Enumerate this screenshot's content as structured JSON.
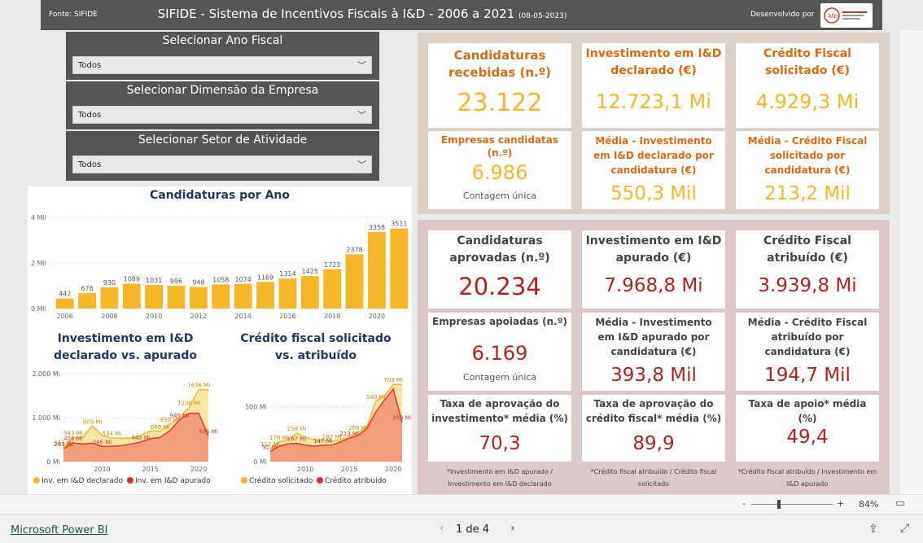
{
  "header": {
    "source": "Fonte: SIFIDE",
    "title": "SIFIDE - Sistema de Incentivos Fiscais à I&D - 2006 a 2021",
    "date": "(08-05-2023)",
    "developed_by": "Desenvolvido por",
    "logo_text": "ANI"
  },
  "slicers": [
    {
      "title": "Selecionar Ano Fiscal",
      "value": "Todos"
    },
    {
      "title": "Selecionar Dimensão da Empresa",
      "value": "Todos"
    },
    {
      "title": "Selecionar Setor de Atividade",
      "value": "Todos"
    }
  ],
  "chart_data": [
    {
      "type": "bar",
      "title": "Candidaturas por Ano",
      "categories": [
        "2006",
        "2007",
        "2008",
        "2009",
        "2010",
        "2011",
        "2012",
        "2013",
        "2014",
        "2015",
        "2016",
        "2017",
        "2018",
        "2019",
        "2020",
        "2021"
      ],
      "values": [
        442,
        676,
        930,
        1089,
        1031,
        996,
        948,
        1058,
        1074,
        1169,
        1314,
        1425,
        1723,
        2378,
        3358,
        3511
      ],
      "x_tick_labels": [
        "2006",
        "2008",
        "2010",
        "2012",
        "2014",
        "2016",
        "2018",
        "2020"
      ],
      "y_tick_labels": [
        "0 Mil",
        "2 Mil",
        "4 Mil"
      ],
      "ylim": [
        0,
        4000
      ],
      "color": "#f5b728"
    },
    {
      "type": "area",
      "title": "Investimento em I&D declarado vs. apurado",
      "x": [
        2006,
        2007,
        2008,
        2009,
        2010,
        2011,
        2012,
        2013,
        2014,
        2015,
        2016,
        2017,
        2018,
        2019,
        2020,
        2021
      ],
      "series": [
        {
          "name": "Inv. em I&D declarado",
          "color": "#f5b728",
          "values": [
            323,
            543,
            560,
            809,
            600,
            534,
            530,
            540,
            600,
            700,
            689,
            850,
            1000,
            1230,
            1636,
            1636
          ]
        },
        {
          "name": "Inv. em I&D apurado",
          "color": "#e85c4a",
          "values": [
            293,
            426,
            400,
            420,
            346,
            350,
            360,
            400,
            445,
            520,
            550,
            700,
            945,
            1100,
            1100,
            585
          ]
        }
      ],
      "data_labels": [
        {
          "text": "323 Mi",
          "series": 0,
          "x": 2006
        },
        {
          "text": "543 Mi",
          "series": 0,
          "x": 2007
        },
        {
          "text": "809 Mi",
          "series": 0,
          "x": 2009
        },
        {
          "text": "534 Mi",
          "series": 0,
          "x": 2011
        },
        {
          "text": "689 Mi",
          "series": 0,
          "x": 2016
        },
        {
          "text": "850 Mi",
          "series": 0,
          "x": 2017
        },
        {
          "text": "1230 Mi",
          "series": 0,
          "x": 2019
        },
        {
          "text": "1636 Mi",
          "series": 0,
          "x": 2020
        },
        {
          "text": "293 Mi",
          "series": 1,
          "x": 2006
        },
        {
          "text": "426 Mi",
          "series": 1,
          "x": 2007
        },
        {
          "text": "346 Mi",
          "series": 1,
          "x": 2010
        },
        {
          "text": "445 Mi",
          "series": 1,
          "x": 2014
        },
        {
          "text": "945 Mi",
          "series": 1,
          "x": 2018
        },
        {
          "text": "585 Mi",
          "series": 1,
          "x": 2021
        }
      ],
      "x_tick_labels": [
        "2010",
        "2015",
        "2020"
      ],
      "y_tick_labels": [
        "0 Mi",
        "1.000 Mi",
        "2.000 Mi"
      ],
      "ylim": [
        0,
        2000
      ]
    },
    {
      "type": "area",
      "title": "Crédito fiscal solicitado vs. atribuído",
      "x": [
        2006,
        2007,
        2008,
        2009,
        2010,
        2011,
        2012,
        2013,
        2014,
        2015,
        2016,
        2017,
        2018,
        2019,
        2020,
        2021
      ],
      "series": [
        {
          "name": "Crédito solicitado",
          "color": "#f5b728",
          "values": [
            117,
            178,
            200,
            258,
            220,
            200,
            190,
            187,
            200,
            230,
            268,
            320,
            549,
            600,
            703,
            703
          ]
        },
        {
          "name": "Crédito atribuído",
          "color": "#e85c4a",
          "values": [
            92,
            140,
            160,
            167,
            150,
            140,
            147,
            150,
            180,
            213,
            240,
            300,
            450,
            560,
            660,
            358
          ]
        }
      ],
      "data_labels": [
        {
          "text": "117 Mi",
          "series": 0,
          "x": 2006
        },
        {
          "text": "178 Mi",
          "series": 0,
          "x": 2007
        },
        {
          "text": "258 Mi",
          "series": 0,
          "x": 2009
        },
        {
          "text": "187 Mi",
          "series": 0,
          "x": 2013
        },
        {
          "text": "268 Mi",
          "series": 0,
          "x": 2016
        },
        {
          "text": "549 Mi",
          "series": 0,
          "x": 2018
        },
        {
          "text": "703 Mi",
          "series": 0,
          "x": 2020
        },
        {
          "text": "92 Mi",
          "series": 1,
          "x": 2006
        },
        {
          "text": "167 Mi",
          "series": 1,
          "x": 2009
        },
        {
          "text": "147 Mi",
          "series": 1,
          "x": 2012
        },
        {
          "text": "213 Mi",
          "series": 1,
          "x": 2015
        },
        {
          "text": "358 Mi",
          "series": 1,
          "x": 2021
        }
      ],
      "x_tick_labels": [
        "2010",
        "2015",
        "2020"
      ],
      "y_tick_labels": [
        "0 Mi",
        "500 Mi"
      ],
      "ylim": [
        0,
        800
      ]
    }
  ],
  "kpi_top": [
    {
      "label": "Candidaturas recebidas (n.º)",
      "value": "23.122"
    },
    {
      "label": "Investimento em I&D declarado (€)",
      "value": "12.723,1 Mi"
    },
    {
      "label": "Crédito Fiscal solicitado (€)",
      "value": "4.929,3 Mi"
    },
    {
      "label": "Empresas candidatas (n.º)",
      "value": "6.986",
      "sub": "Contagem única"
    },
    {
      "label": "Média - Investimento em I&D declarado por candidatura (€)",
      "value": "550,3 Mil"
    },
    {
      "label": "Média - Crédito Fiscal solicitado por candidatura (€)",
      "value": "213,2 Mil"
    }
  ],
  "kpi_bot": [
    {
      "label": "Candidaturas aprovadas (n.º)",
      "value": "20.234"
    },
    {
      "label": "Investimento em I&D apurado (€)",
      "value": "7.968,8 Mi"
    },
    {
      "label": "Crédito Fiscal atribuído (€)",
      "value": "3.939,8 Mi"
    },
    {
      "label": "Empresas apoiadas (n.º)",
      "value": "6.169",
      "sub": "Contagem única"
    },
    {
      "label": "Média - Investimento em I&D apurado por candidatura (€)",
      "value": "393,8 Mil"
    },
    {
      "label": "Média - Crédito Fiscal atribuído por candidatura (€)",
      "value": "194,7 Mil"
    },
    {
      "label": "Taxa de aprovação do investimento* média (%)",
      "value": "70,3"
    },
    {
      "label": "Taxa de aprovação do crédito fiscal* média (%)",
      "value": "89,9"
    },
    {
      "label": "Taxa de apoio* média (%)",
      "value": "49,4"
    }
  ],
  "footnotes": [
    "*Investimento em I&D apurado / Investimento em I&D declarado",
    "*Crédito fiscal atribuído / Crédito fiscal solicitado",
    "*Crédito fiscal atribuído / Investimento em I&D apurado"
  ],
  "zoom": {
    "minus": "-",
    "plus": "+",
    "level": "84%",
    "value": 0.84
  },
  "footer": {
    "brand": "Microsoft Power BI",
    "page": "1 de 4"
  }
}
